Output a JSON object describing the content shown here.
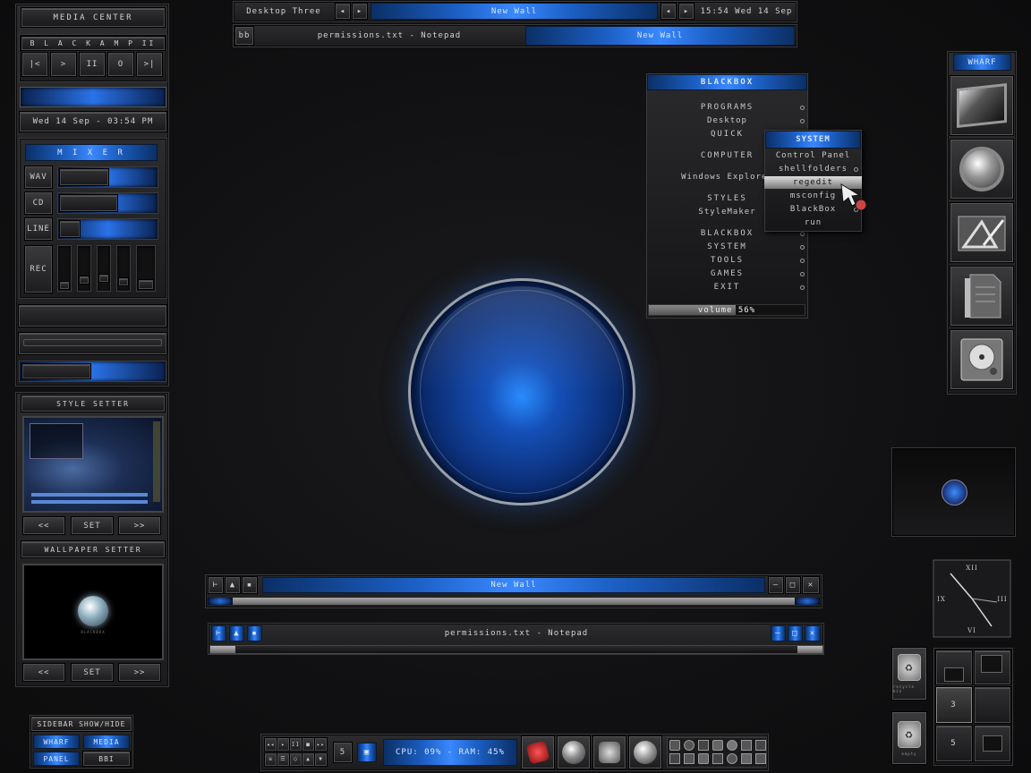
{
  "left_sidebar": {
    "media_center": "MEDIA CENTER",
    "player_title": "B L A C K A M P  II",
    "player_buttons": [
      "|<",
      ">",
      "II",
      "O",
      ">|"
    ],
    "datetime": "Wed 14 Sep - 03:54 PM",
    "mixer_title": "M I X E R",
    "mixer_channels": [
      {
        "label": "WAV",
        "level": 0.6
      },
      {
        "label": "CD",
        "level": 0.7
      },
      {
        "label": "LINE",
        "level": 0.2
      },
      {
        "label": "REC",
        "level": 0.5
      }
    ],
    "style_setter_title": "STYLE SETTER",
    "wallpaper_setter_title": "WALLPAPER SETTER",
    "prev_label": "<<",
    "set_label": "SET",
    "next_label": ">>",
    "wallpaper_preview_caption": "BLACKBOX"
  },
  "toggles": {
    "title": "SIDEBAR SHOW/HIDE",
    "wharf": "WHARF",
    "media": "MEDIA",
    "panel": "PANEL",
    "bbi": "BBI"
  },
  "top_toolbar": {
    "workspace": "Desktop Three",
    "window_label": "New Wall",
    "clock": "15:54 Wed 14 Sep",
    "bb": "bb",
    "task1": "permissions.txt - Notepad",
    "task2": "New Wall"
  },
  "blackbox_menu": {
    "title": "BLACKBOX",
    "items": [
      "PROGRAMS",
      "Desktop",
      "QUICK",
      "COMPUTER",
      "Windows Explorer",
      "STYLES",
      "StyleMaker",
      "BLACKBOX",
      "SYSTEM",
      "TOOLS",
      "GAMES",
      "EXIT"
    ],
    "volume_label": "volume 56%",
    "volume_level": 0.56
  },
  "system_menu": {
    "title": "SYSTEM",
    "items": [
      "Control Panel",
      "shellfolders",
      "regedit",
      "msconfig",
      "BlackBox",
      "run"
    ]
  },
  "windows": {
    "new_wall_title": "New Wall",
    "notepad_title": "permissions.txt - Notepad"
  },
  "wharf": {
    "title": "WHARF",
    "icons": [
      "monitor-icon",
      "globe-icon",
      "graphics-tools-icon",
      "document-icon",
      "hard-drive-icon"
    ]
  },
  "clock": {
    "numerals": [
      "XII",
      "III",
      "VI",
      "IX"
    ]
  },
  "bottom_bar": {
    "stats": "CPU: 09% - RAM: 45%",
    "workspace_number": "5"
  },
  "pager": {
    "cells": [
      "",
      "",
      "3",
      "",
      "5",
      ""
    ]
  },
  "recycle_labels": [
    "recycle bin",
    "empty"
  ],
  "colors": {
    "accent_blue": "#2a72e8",
    "dark_bg": "#111113"
  }
}
